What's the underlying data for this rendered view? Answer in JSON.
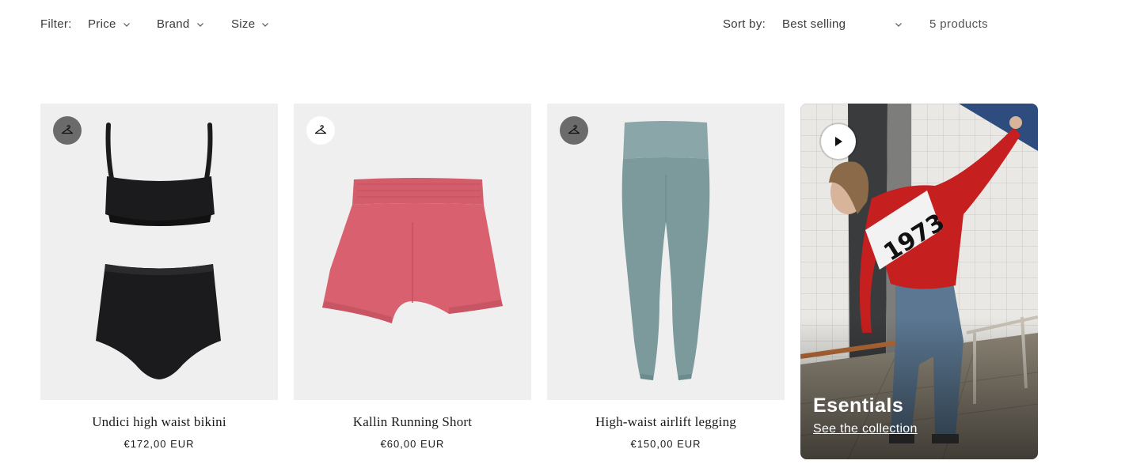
{
  "filter": {
    "label": "Filter:",
    "dropdowns": [
      {
        "label": "Price"
      },
      {
        "label": "Brand"
      },
      {
        "label": "Size"
      }
    ]
  },
  "sort": {
    "label": "Sort by:",
    "selected": "Best selling"
  },
  "product_count": "5 products",
  "products": [
    {
      "title": "Undici high waist bikini",
      "price": "€172,00 EUR",
      "quick_button_style": "dark",
      "icon": "hanger-icon"
    },
    {
      "title": "Kallin Running Short",
      "price": "€60,00 EUR",
      "quick_button_style": "light",
      "icon": "hanger-icon"
    },
    {
      "title": "High-waist airlift legging",
      "price": "€150,00 EUR",
      "quick_button_style": "dark",
      "icon": "hanger-icon"
    }
  ],
  "promo": {
    "title": "Esentials",
    "link": "See the collection",
    "play_icon": "play-icon"
  },
  "colors": {
    "card_bg": "#efefef",
    "bikini": "#1b1b1d",
    "shorts": "#d9616f",
    "legging": "#7c9a9c",
    "sweater": "#c61f1f"
  }
}
